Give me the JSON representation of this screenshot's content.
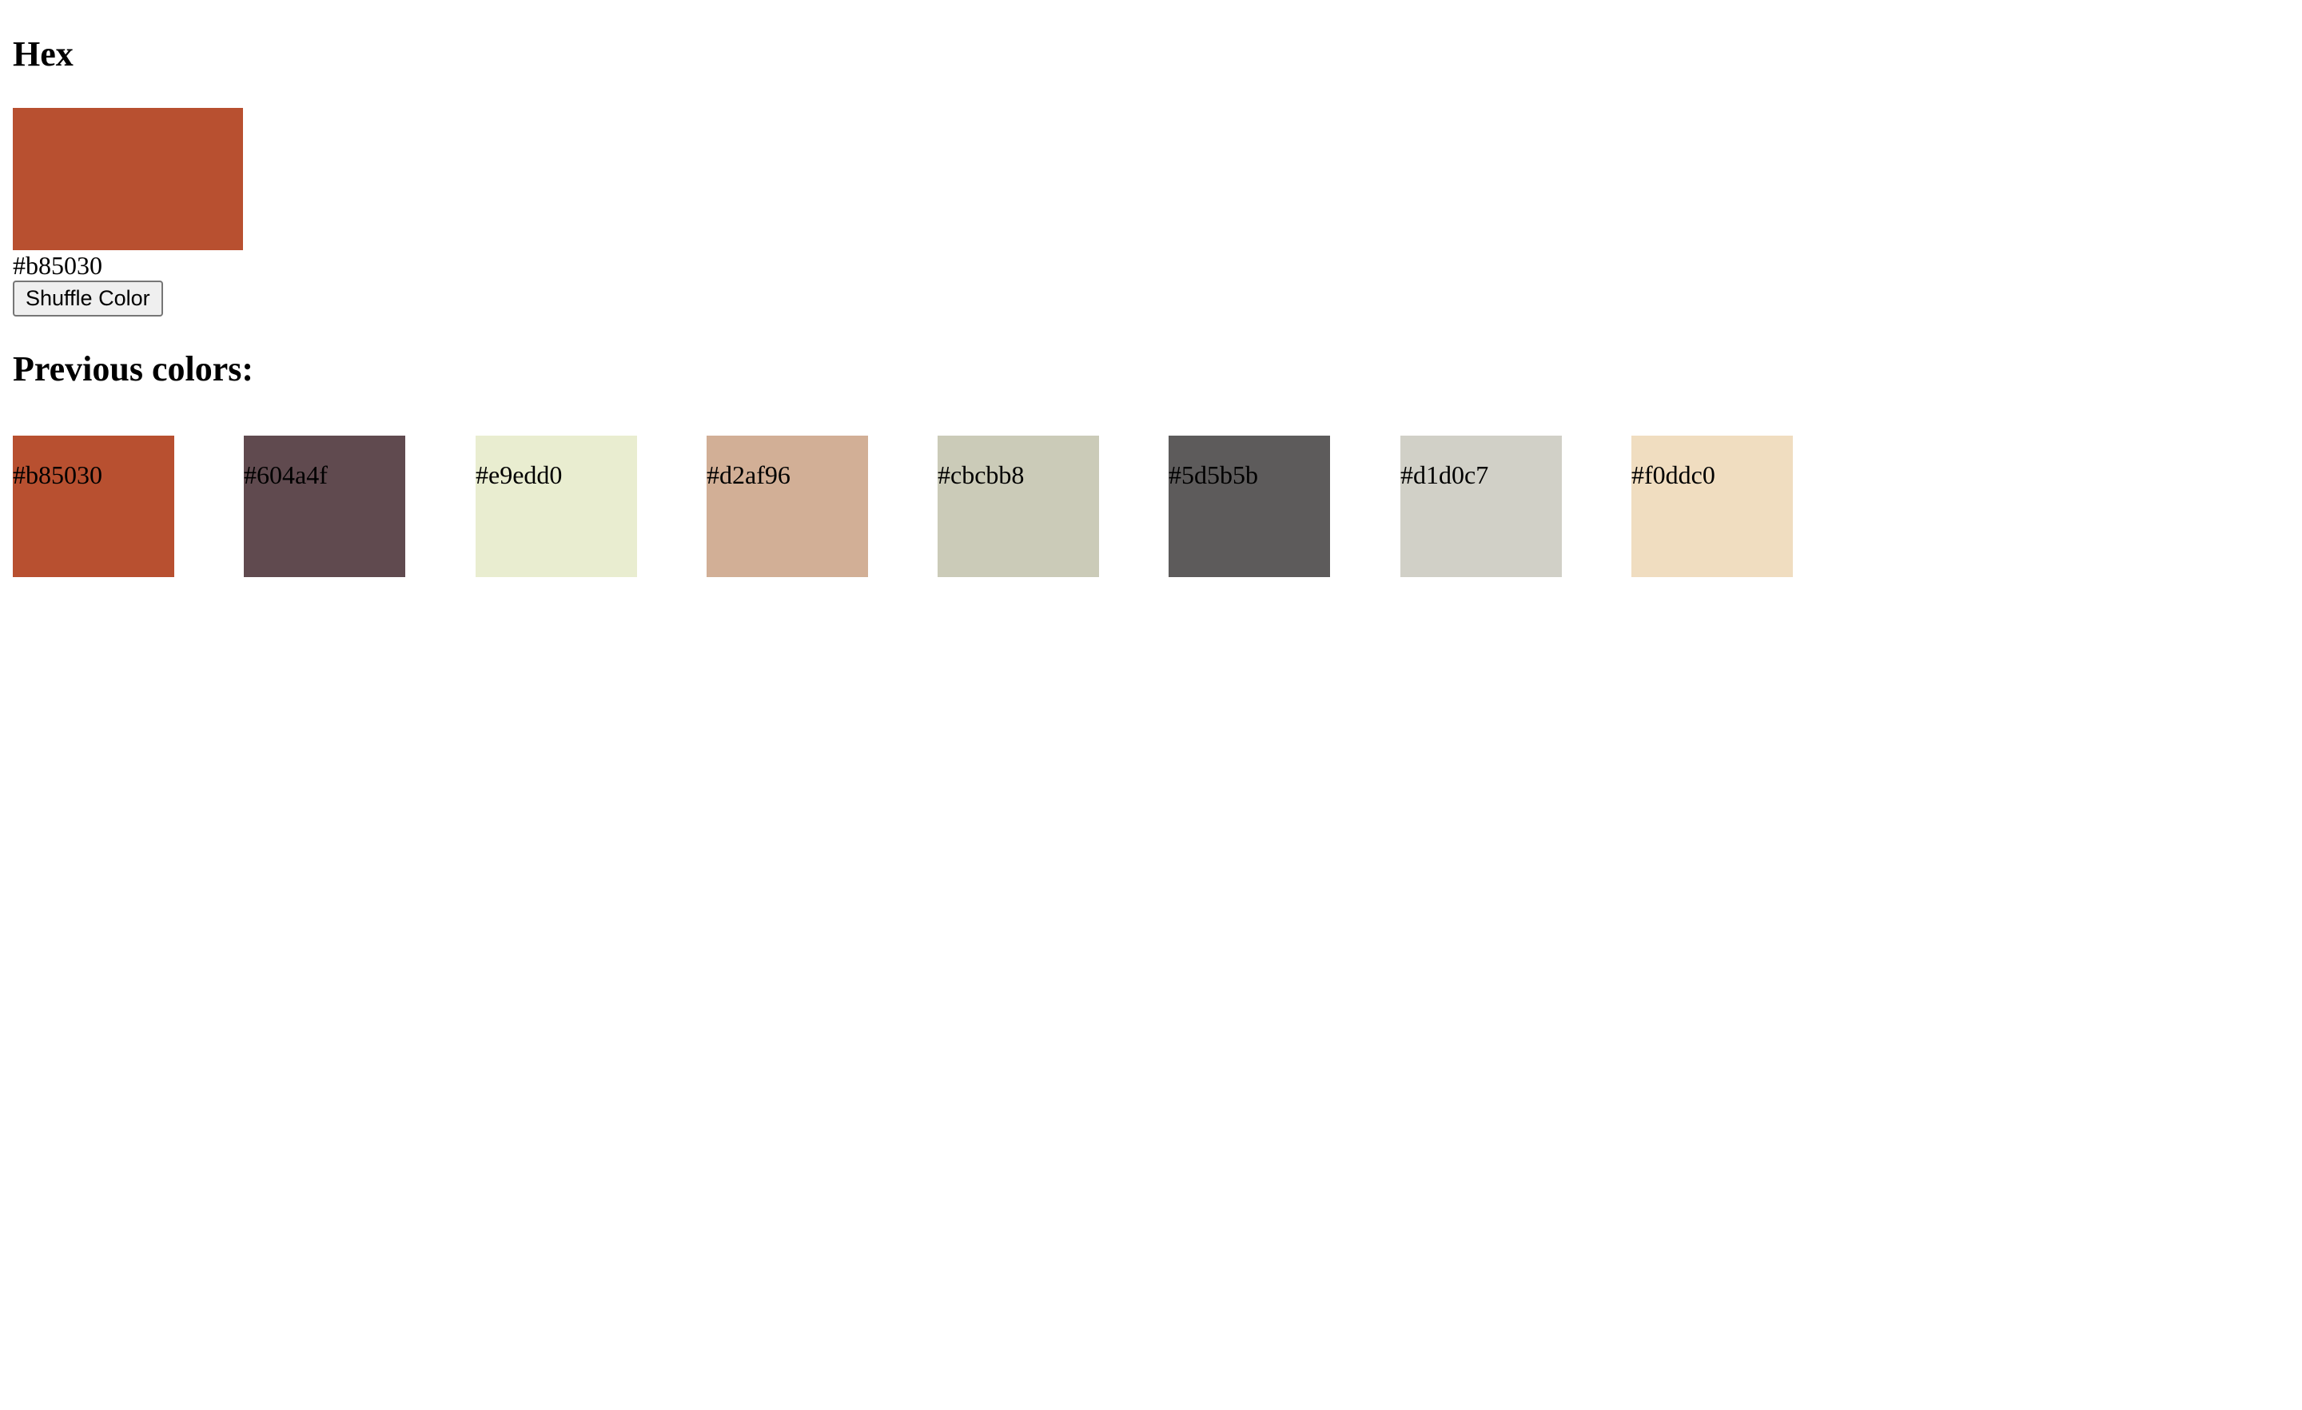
{
  "title": "Hex",
  "current": {
    "hex": "#b85030",
    "color": "#b85030"
  },
  "shuffle_label": "Shuffle Color",
  "previous_title": "Previous colors:",
  "previous": [
    {
      "hex": "#b85030",
      "color": "#b85030"
    },
    {
      "hex": "#604a4f",
      "color": "#604a4f"
    },
    {
      "hex": "#e9edd0",
      "color": "#e9edd0"
    },
    {
      "hex": "#d2af96",
      "color": "#d2af96"
    },
    {
      "hex": "#cbcbb8",
      "color": "#cbcbb8"
    },
    {
      "hex": "#5d5b5b",
      "color": "#5d5b5b"
    },
    {
      "hex": "#d1d0c7",
      "color": "#d1d0c7"
    },
    {
      "hex": "#f0ddc0",
      "color": "#f0ddc0"
    }
  ]
}
